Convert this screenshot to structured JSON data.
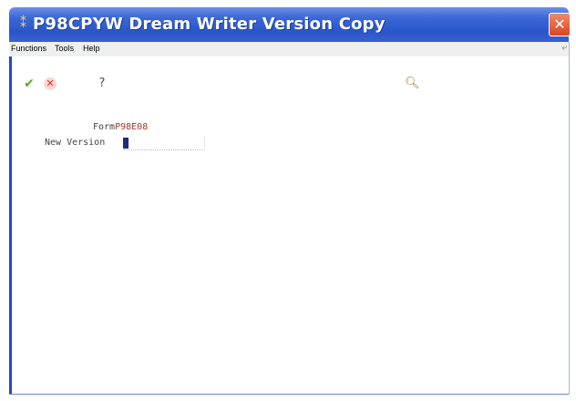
{
  "window": {
    "title": "P98CPYW  Dream Writer Version Copy",
    "close_glyph": "✕",
    "app_icon": "program-icon"
  },
  "menubar": {
    "items": [
      {
        "label": "Functions"
      },
      {
        "label": "Tools"
      },
      {
        "label": "Help"
      }
    ]
  },
  "toolbar": {
    "ok_icon": "check-icon",
    "cancel_icon": "cancel-icon",
    "help_label": "?",
    "search_icon": "magnifier-icon"
  },
  "form": {
    "form_label": "Form",
    "form_code": "P98E08",
    "new_version_label": "New Version",
    "new_version_value": ""
  },
  "colors": {
    "titlebar": "#2b56c9",
    "form_code": "#a33a2c",
    "caret": "#1f2a7a",
    "ok": "#5aa52b",
    "cancel": "#d8322a"
  }
}
